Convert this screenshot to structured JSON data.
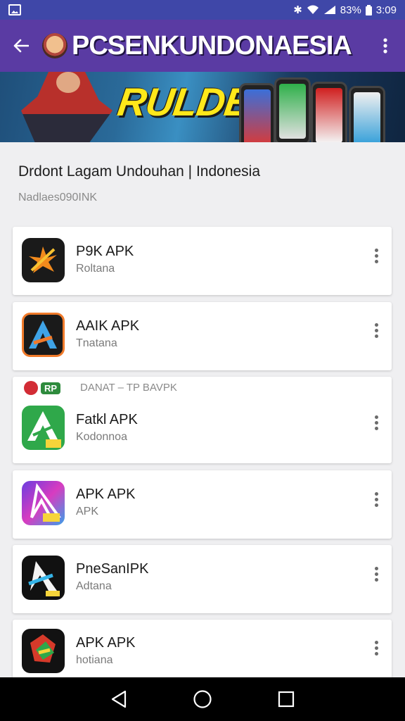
{
  "status_bar": {
    "bluetooth_icon": "bluetooth-icon",
    "wifi_icon": "wifi-icon",
    "battery_text": "83%",
    "time": "3:09"
  },
  "app_bar": {
    "title": "PCSENKUNDONAESIA",
    "back_icon": "arrow-left-icon",
    "menu_icon": "more-vertical-icon"
  },
  "banner": {
    "text": "RULDEAA!"
  },
  "section": {
    "title": "Drdont Lagam  Undouhan  | Indonesia",
    "subtitle": "Nadlaes090INK"
  },
  "apps": [
    {
      "name": "P9K APK",
      "subtitle": "Roltana"
    },
    {
      "name": "AAIK APK",
      "subtitle": "Tnatana"
    },
    {
      "name": "Fatkl APK",
      "subtitle": "Kodonnoa",
      "badge_pill": "RP",
      "badge_text": "DANAT – TP BAVPK"
    },
    {
      "name": "APK APK",
      "subtitle": "APK"
    },
    {
      "name": "PneSanIPK",
      "subtitle": "Adtana"
    },
    {
      "name": "APK APK",
      "subtitle": "hotiana"
    }
  ],
  "nav": {
    "back": "back-triangle-icon",
    "home": "home-circle-icon",
    "recents": "recents-square-icon"
  },
  "colors": {
    "status_bar": "#3f47a8",
    "app_bar": "#5a3ba3",
    "background": "#efeff1",
    "card": "#ffffff"
  }
}
